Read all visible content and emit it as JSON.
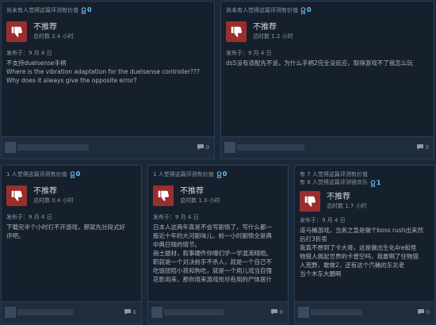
{
  "reviews": [
    {
      "helpful_lines": [
        "尚未有人觉得这篇评测有价值"
      ],
      "award_count": "0",
      "verdict": "不推荐",
      "hours": "总时数 2.4 小时",
      "posted": "发布于：9 月 4 日",
      "body_lines": [
        "不支持duelsense手柄",
        "Where is the vibration adaptation for the duelsense controller???",
        "Why does it always give the opposite error?"
      ],
      "comments": "0"
    },
    {
      "helpful_lines": [
        "尚未有人觉得这篇评测有价值"
      ],
      "award_count": "0",
      "verdict": "不推荐",
      "hours": "总时数 1.2 小时",
      "posted": "发布于：9 月 4 日",
      "body_lines": [
        "ds5没有适配先不说，为什么手柄2完全没反应，取得游戏不了我怎么玩"
      ],
      "comments": "0"
    },
    {
      "helpful_lines": [
        "1 人觉得这篇评测有价值"
      ],
      "award_count": "0",
      "verdict": "不推荐",
      "hours": "总时数 0.4 小时",
      "posted": "发布于：9 月 4 日",
      "body_lines": [
        "下载完半个小时打不开游戏，那就先分段式好",
        "评吧。"
      ],
      "comments": "0"
    },
    {
      "helpful_lines": [
        "1 人觉得这篇评测有价值"
      ],
      "award_count": "0",
      "verdict": "不推荐",
      "hours": "总时数 1.3 小时",
      "posted": "发布于：9 月 4 日",
      "body_lines": [
        "日本人这两年真是不会写剧情了，写什么都一",
        "股近十年的大河剧味儿，前一小时剧情全是典",
        "中典日晴的情节。",
        "画士题材，叙事硬件你哪们学一学混淆晴昭。",
        "职就是一个对决前手不杀人，就是一个自己不",
        "吃饭团陪小孩和狗吃，就是一个用儿戏当自强",
        "花影用来，那你用来游戏抢尽有用的尸体居什"
      ],
      "comments": "0"
    },
    {
      "helpful_lines": [
        "有 7 人觉得这篇评测有价值",
        "有 8 人觉得这篇评测很欢乐"
      ],
      "award_count": "1",
      "verdict": "不推荐",
      "hours": "总时数 1.7 小时",
      "posted": "发布于：9 月 4 日",
      "body_lines": [
        "道马桶游戏，当务之急是做个boss rush出来然",
        "后打3折卖",
        "我真不想到了卡大哥，这是做出生化4re和怪",
        "物猎人佩起世界的卡普空吗，我敢啊了住物猎",
        "人荒野，敢做2，还有这个汽桶的东北老",
        "当个木东大鹏啊"
      ],
      "comments": "0"
    }
  ]
}
